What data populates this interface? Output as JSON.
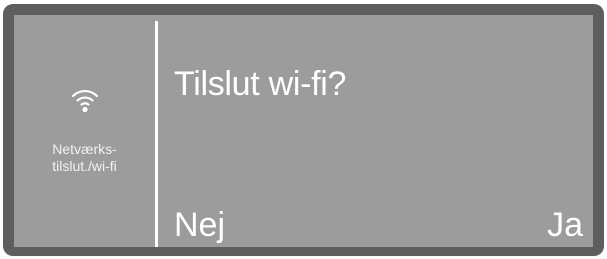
{
  "sidebar": {
    "icon": "wifi-icon",
    "label_line1": "Netværks-",
    "label_line2": "tilslut./wi-fi"
  },
  "dialog": {
    "prompt": "Tilslut wi-fi?",
    "no_label": "Nej",
    "yes_label": "Ja"
  },
  "colors": {
    "frame": "#5e5e5e",
    "screen": "#9c9c9c",
    "text": "#ffffff"
  }
}
